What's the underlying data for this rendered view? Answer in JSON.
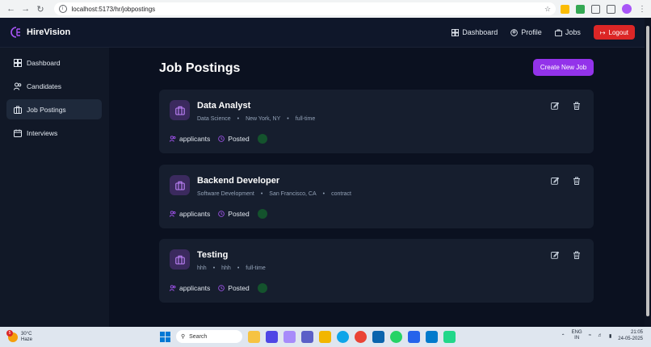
{
  "browser": {
    "url": "localhost:5173/hr/jobpostings"
  },
  "brand": {
    "name": "HireVision"
  },
  "header": {
    "nav": [
      {
        "label": "Dashboard",
        "icon": "dashboard-icon"
      },
      {
        "label": "Profile",
        "icon": "profile-icon"
      },
      {
        "label": "Jobs",
        "icon": "briefcase-icon"
      }
    ],
    "logout_label": "Logout"
  },
  "sidebar": {
    "items": [
      {
        "label": "Dashboard",
        "icon": "grid-icon",
        "active": false
      },
      {
        "label": "Candidates",
        "icon": "users-icon",
        "active": false
      },
      {
        "label": "Job Postings",
        "icon": "briefcase-icon",
        "active": true
      },
      {
        "label": "Interviews",
        "icon": "calendar-icon",
        "active": false
      }
    ]
  },
  "main": {
    "title": "Job Postings",
    "create_label": "Create New Job",
    "jobs": [
      {
        "title": "Data Analyst",
        "department": "Data Science",
        "location": "New York, NY",
        "type": "full-time",
        "applicants_label": "applicants",
        "posted_label": "Posted"
      },
      {
        "title": "Backend Developer",
        "department": "Software Development",
        "location": "San Francisco, CA",
        "type": "contract",
        "applicants_label": "applicants",
        "posted_label": "Posted"
      },
      {
        "title": "Testing",
        "department": "hhh",
        "location": "hhh",
        "type": "full-time",
        "applicants_label": "applicants",
        "posted_label": "Posted"
      }
    ]
  },
  "taskbar": {
    "weather_temp": "30°C",
    "weather_desc": "Haze",
    "weather_badge": "5",
    "search_placeholder": "Search",
    "lang_top": "ENG",
    "lang_bottom": "IN",
    "time": "21:05",
    "date": "24-05-2025"
  },
  "colors": {
    "accent": "#9333ea",
    "logout": "#dc2626",
    "background": "#0b1120",
    "card": "#161e2e"
  }
}
